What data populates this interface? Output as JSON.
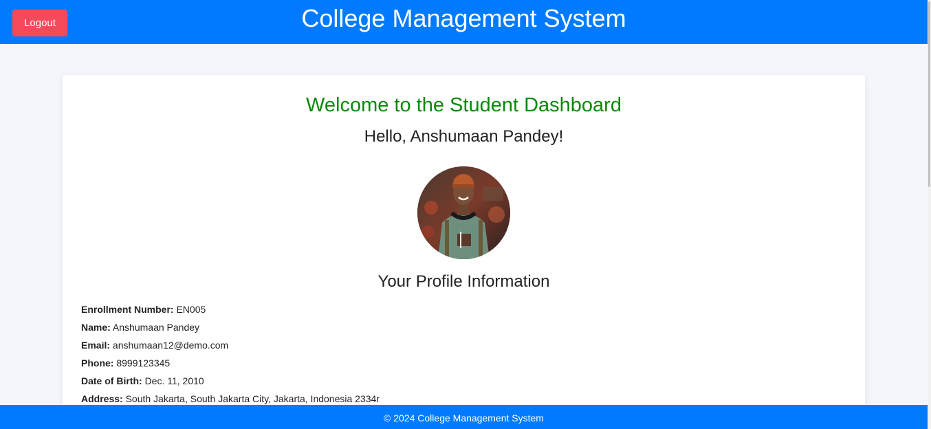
{
  "header": {
    "title": "College Management System",
    "logout_label": "Logout"
  },
  "dashboard": {
    "welcome": "Welcome to the Student Dashboard",
    "greeting": "Hello, Anshumaan Pandey!",
    "profile_heading": "Your Profile Information"
  },
  "profile": [
    {
      "label": "Enrollment Number:",
      "value": "EN005"
    },
    {
      "label": "Name:",
      "value": "Anshumaan Pandey"
    },
    {
      "label": "Email:",
      "value": "anshumaan12@demo.com"
    },
    {
      "label": "Phone:",
      "value": "8999123345"
    },
    {
      "label": "Date of Birth:",
      "value": "Dec. 11, 2010"
    },
    {
      "label": "Address:",
      "value": "South Jakarta, South Jakarta City, Jakarta, Indonesia 2334r"
    }
  ],
  "footer": {
    "text": "© 2024 College Management System"
  },
  "colors": {
    "header_bg": "#007bff",
    "logout_bg": "#f44a5b",
    "welcome_text": "#0a8a0a"
  },
  "icons": {
    "avatar": "student-avatar-photo"
  }
}
